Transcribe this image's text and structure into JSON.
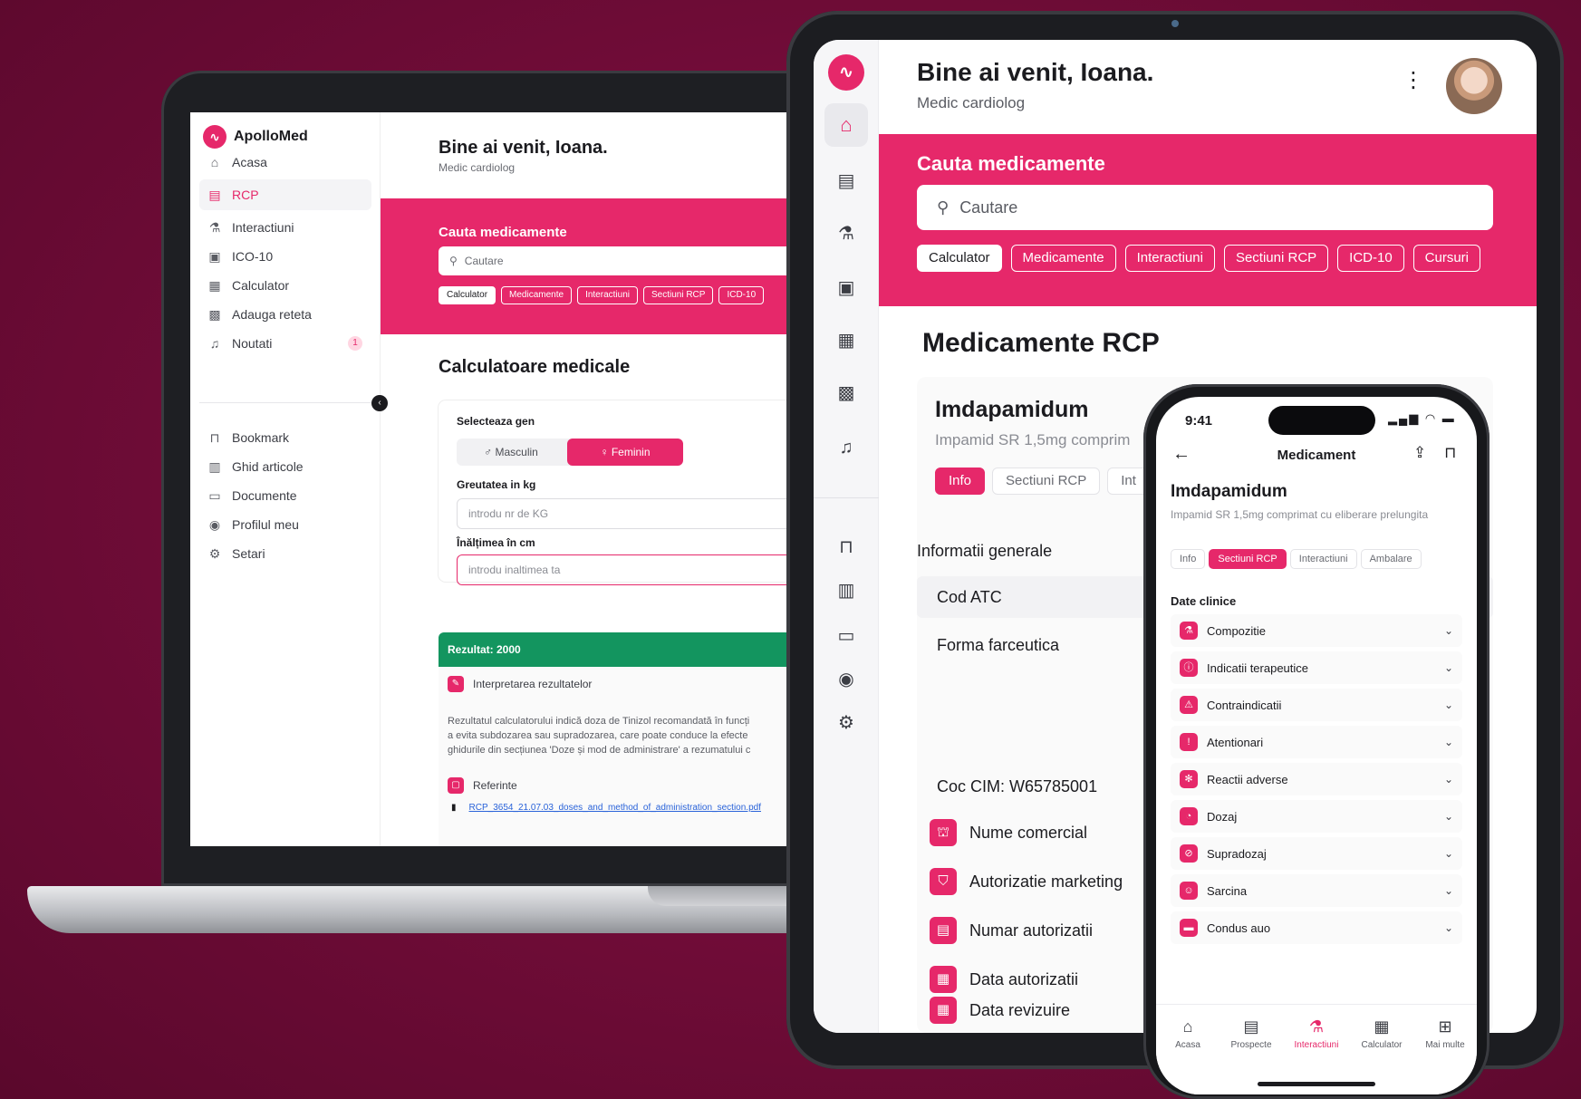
{
  "brand": {
    "name": "ApolloMed",
    "accent": "#e6286a",
    "success": "#13955f"
  },
  "laptop": {
    "sidebar": {
      "items": [
        {
          "label": "Acasa",
          "icon": "home-icon"
        },
        {
          "label": "RCP",
          "icon": "bottle-icon",
          "active": true
        },
        {
          "label": "Interactiuni",
          "icon": "flask-icon"
        },
        {
          "label": "ICO-10",
          "icon": "clipboard-icon"
        },
        {
          "label": "Calculator",
          "icon": "calculator-icon"
        },
        {
          "label": "Adauga reteta",
          "icon": "qr-icon"
        },
        {
          "label": "Noutati",
          "icon": "bell-icon",
          "badge": "1"
        }
      ],
      "items2": [
        {
          "label": "Bookmark",
          "icon": "bookmark-icon"
        },
        {
          "label": "Ghid articole",
          "icon": "newspaper-icon"
        },
        {
          "label": "Documente",
          "icon": "folder-icon"
        },
        {
          "label": "Profilul meu",
          "icon": "user-circle-icon"
        },
        {
          "label": "Setari",
          "icon": "gear-icon"
        }
      ]
    },
    "header": {
      "welcome": "Bine ai venit, Ioana.",
      "role": "Medic cardiolog"
    },
    "search": {
      "title": "Cauta medicamente",
      "placeholder": "Cautare",
      "chips": [
        "Calculator",
        "Medicamente",
        "Interactiuni",
        "Sectiuni RCP",
        "ICD-10"
      ]
    },
    "calculator": {
      "title": "Calculatoare medicale",
      "gender_label": "Selecteaza gen",
      "male": "♂ Masculin",
      "female": "♀ Feminin",
      "weight_label": "Greutatea in kg",
      "weight_placeholder": "introdu nr de KG",
      "height_label": "Înălțimea în cm",
      "height_placeholder": "introdu inaltimea ta"
    },
    "result": {
      "title": "Rezultat: 2000",
      "interp_title": "Interpretarea rezultatelor",
      "interp_text_1": "Rezultatul calculatorului indică doza de Tinizol recomandată în funcți",
      "interp_text_2": "a evita subdozarea sau supradozarea, care poate conduce la efecte",
      "interp_text_3": "ghidurile din secțiunea 'Doze și mod de administrare' a rezumatului c",
      "ref_title": "Referinte",
      "ref_link": "RCP_3654_21.07.03_doses_and_method_of_administration_section.pdf"
    }
  },
  "tablet": {
    "header": {
      "welcome": "Bine ai venit, Ioana.",
      "role": "Medic cardiolog"
    },
    "search": {
      "title": "Cauta medicamente",
      "placeholder": "Cautare",
      "chips": [
        "Calculator",
        "Medicamente",
        "Interactiuni",
        "Sectiuni RCP",
        "ICD-10",
        "Cursuri"
      ]
    },
    "section_title": "Medicamente RCP",
    "drug": {
      "name": "Imdapamidum",
      "subtitle": "Impamid SR 1,5mg comprim",
      "tabs": [
        "Info",
        "Sectiuni RCP",
        "Int"
      ]
    },
    "info": {
      "title": "Informatii generale",
      "cod_atc": "Cod ATC",
      "forma": "Forma farceutica",
      "cim": "Coc CIM: W65785001",
      "items": [
        "Nume comercial",
        "Autorizatie marketing",
        "Numar autorizatii",
        "Data autorizatii",
        "Data revizuire"
      ]
    }
  },
  "phone": {
    "time": "9:41",
    "status": "▂▄▆ ◠ ▬",
    "nav_title": "Medicament",
    "drug": {
      "name": "Imdapamidum",
      "subtitle": "Impamid SR 1,5mg comprimat cu eliberare prelungita",
      "tabs": [
        "Info",
        "Sectiuni RCP",
        "Interactiuni",
        "Ambalare"
      ]
    },
    "section_title": "Date clinice",
    "rows": [
      "Compozitie",
      "Indicatii terapeutice",
      "Contraindicatii",
      "Atentionari",
      "Reactii adverse",
      "Dozaj",
      "Supradozaj",
      "Sarcina",
      "Condus auo"
    ],
    "tabbar": [
      "Acasa",
      "Prospecte",
      "Interactiuni",
      "Calculator",
      "Mai multe"
    ]
  }
}
